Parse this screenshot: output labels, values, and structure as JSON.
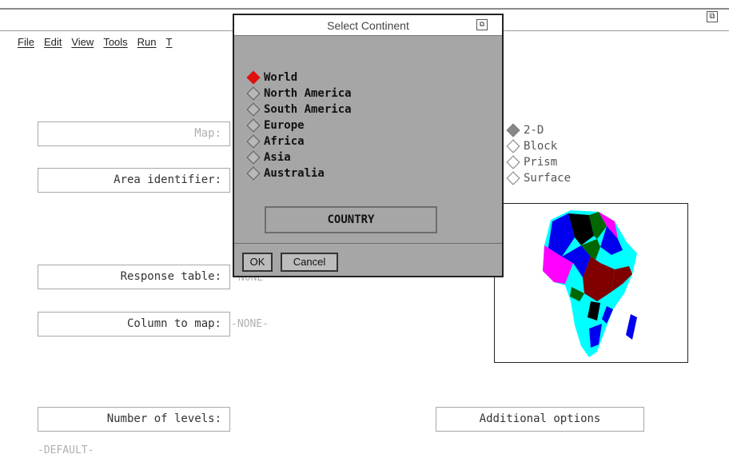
{
  "menu": [
    "File",
    "Edit",
    "View",
    "Tools",
    "Run",
    "T"
  ],
  "fields": {
    "map_label": "Map:",
    "area_label": "Area identifier:",
    "response_label": "Response table:",
    "response_value": "NONE",
    "column_label": "Column to map:",
    "column_value": "-NONE-",
    "levels_label": "Number of levels:",
    "levels_value": "-DEFAULT-",
    "additional_options": "Additional options"
  },
  "map_types": {
    "options": [
      "2-D",
      "Block",
      "Prism",
      "Surface"
    ],
    "selected": "2-D"
  },
  "dialog": {
    "title": "Select Continent",
    "options": [
      "World",
      "North America",
      "South America",
      "Europe",
      "Africa",
      "Asia",
      "Australia"
    ],
    "selected": "World",
    "country_button": "COUNTRY",
    "ok": "OK",
    "cancel": "Cancel"
  },
  "colors": {
    "dialog_bg": "#a6a6a6",
    "selected_radio": "#e01010"
  },
  "preview": {
    "region": "Africa",
    "description_icon": "africa-map-icon"
  }
}
